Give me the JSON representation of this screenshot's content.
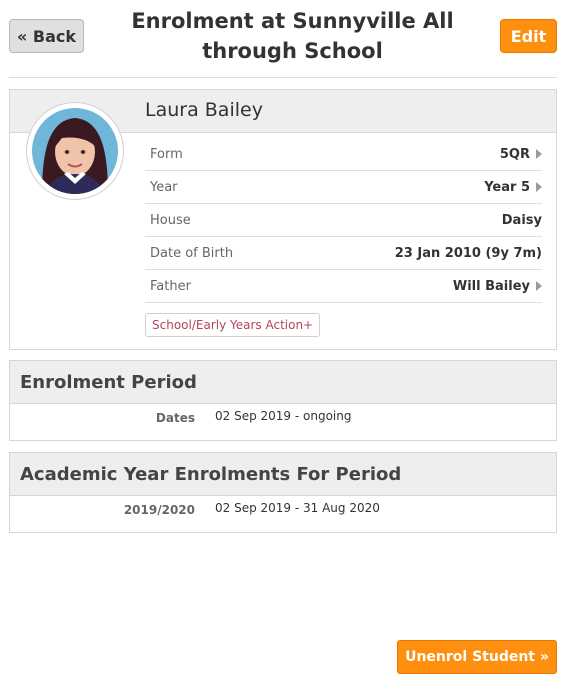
{
  "header": {
    "back_label": "« Back",
    "title": "Enrolment at Sunnyville All through School",
    "edit_label": "Edit"
  },
  "student": {
    "name": "Laura Bailey",
    "details": [
      {
        "label": "Form",
        "value": "5QR",
        "link": true
      },
      {
        "label": "Year",
        "value": "Year 5",
        "link": true
      },
      {
        "label": "House",
        "value": "Daisy",
        "link": false
      },
      {
        "label": "Date of Birth",
        "value": "23 Jan 2010 (9y 7m)",
        "link": false
      },
      {
        "label": "Father",
        "value": "Will Bailey",
        "link": true
      }
    ],
    "action_label": "School/Early Years Action+"
  },
  "enrolment_period": {
    "heading": "Enrolment Period",
    "row_label": "Dates",
    "row_value": "02 Sep 2019 - ongoing"
  },
  "academic_year": {
    "heading": "Academic Year Enrolments For Period",
    "row_label": "2019/2020",
    "row_value": "02 Sep 2019 - 31 Aug 2020"
  },
  "footer": {
    "unenrol_label": "Unenrol Student »"
  },
  "colors": {
    "accent": "#ff8f0e",
    "panel_header": "#eeeeee",
    "action_text": "#b4445a"
  }
}
